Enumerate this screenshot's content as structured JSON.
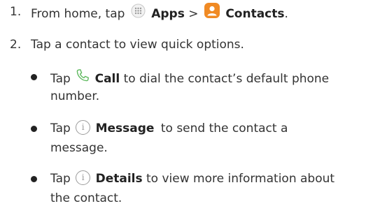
{
  "steps": [
    {
      "number": "1.",
      "prefix": "From home, tap",
      "apps_label": "Apps",
      "separator": ">",
      "contacts_label": "Contacts",
      "suffix": "."
    },
    {
      "number": "2.",
      "text": "Tap a contact to view quick options."
    }
  ],
  "options": [
    {
      "tap": "Tap",
      "icon": "phone-icon",
      "label": "Call",
      "line1_rest": "to dial the contact’s default phone",
      "line2": "number."
    },
    {
      "tap": "Tap",
      "icon": "info-icon",
      "icon_glyph": "i",
      "label": "Message",
      "line1_rest": "to send the contact a",
      "line2": "message."
    },
    {
      "tap": "Tap",
      "icon": "info-icon",
      "icon_glyph": "i",
      "label": "Details",
      "line1_rest": "to view more information about",
      "line2": "the contact."
    }
  ],
  "colors": {
    "text": "#333333",
    "contacts_icon": "#f08a24",
    "call_icon": "#5cb85c",
    "info_icon": "#9a9a9a",
    "apps_icon": "#bdbdbd"
  }
}
